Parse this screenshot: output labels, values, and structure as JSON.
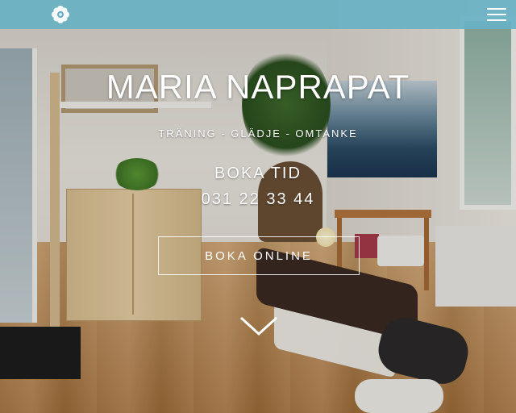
{
  "header": {
    "logo_icon": "flower-logo-icon",
    "menu_icon": "hamburger-menu-icon",
    "bar_color": "#68b2c4"
  },
  "hero": {
    "title": "MARIA NAPRAPAT",
    "tagline": "TRÄNING - GLÄDJE - OMTANKE",
    "booking_heading": "BOKA TID",
    "phone": "031 22 33 44",
    "online_button_label": "BOKA ONLINE",
    "scroll_icon": "chevron-down-icon"
  },
  "colors": {
    "text": "#ffffff"
  }
}
